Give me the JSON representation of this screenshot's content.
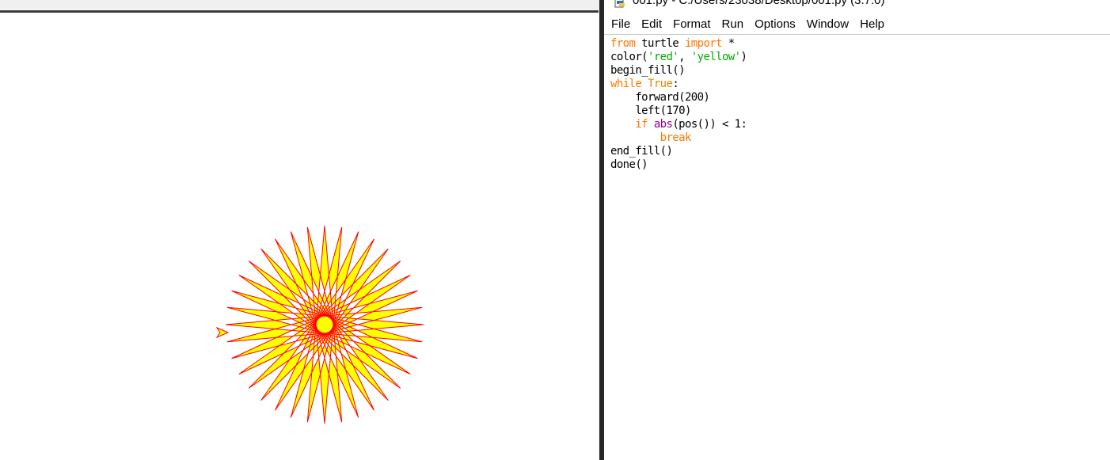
{
  "turtle_window": {
    "fill_color": "#ffff00",
    "pen_color": "#ff0000",
    "cursor_shape": "classic-arrow"
  },
  "idle": {
    "title": "001.py - C:/Users/23038/Desktop/001.py (3.7.0)",
    "title_icon": "python-file-icon",
    "menu": [
      "File",
      "Edit",
      "Format",
      "Run",
      "Options",
      "Window",
      "Help"
    ],
    "code_lines": [
      [
        {
          "t": "from",
          "c": "kw"
        },
        {
          "t": " turtle ",
          "c": "normal"
        },
        {
          "t": "import",
          "c": "kw"
        },
        {
          "t": " *",
          "c": "normal"
        }
      ],
      [
        {
          "t": "color(",
          "c": "normal"
        },
        {
          "t": "'red'",
          "c": "str"
        },
        {
          "t": ", ",
          "c": "normal"
        },
        {
          "t": "'yellow'",
          "c": "str"
        },
        {
          "t": ")",
          "c": "normal"
        }
      ],
      [
        {
          "t": "begin_fill()",
          "c": "normal"
        }
      ],
      [
        {
          "t": "while",
          "c": "kw"
        },
        {
          "t": " ",
          "c": "normal"
        },
        {
          "t": "True",
          "c": "kw2"
        },
        {
          "t": ":",
          "c": "normal"
        }
      ],
      [
        {
          "t": "    forward(200)",
          "c": "normal"
        }
      ],
      [
        {
          "t": "    left(170)",
          "c": "normal"
        }
      ],
      [
        {
          "t": "    ",
          "c": "normal"
        },
        {
          "t": "if",
          "c": "kw"
        },
        {
          "t": " ",
          "c": "normal"
        },
        {
          "t": "abs",
          "c": "bi"
        },
        {
          "t": "(pos()) < 1:",
          "c": "normal"
        }
      ],
      [
        {
          "t": "        ",
          "c": "normal"
        },
        {
          "t": "break",
          "c": "kw"
        }
      ],
      [
        {
          "t": "end_fill()",
          "c": "normal"
        }
      ],
      [
        {
          "t": "done()",
          "c": "normal"
        }
      ]
    ]
  },
  "colors": {
    "keyword": "#ff7700",
    "string": "#00aa00",
    "builtin": "#900090",
    "divider": "#262626"
  }
}
